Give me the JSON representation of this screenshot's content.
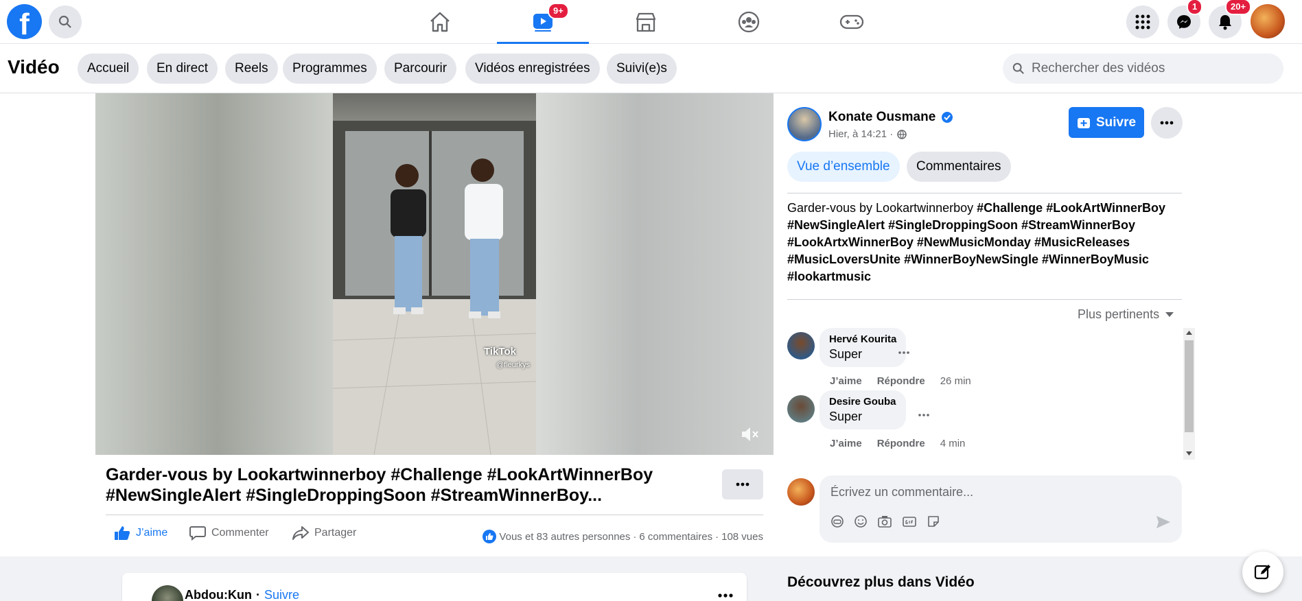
{
  "header": {
    "logo": "f",
    "nav_badges": {
      "video": "9+"
    },
    "right_badges": {
      "messenger": "1",
      "notifications": "20+"
    }
  },
  "subheader": {
    "title": "Vidéo",
    "chips": [
      "Accueil",
      "En direct",
      "Reels",
      "Programmes",
      "Parcourir",
      "Vidéos enregistrées",
      "Suivi(e)s"
    ],
    "search_placeholder": "Rechercher des vidéos"
  },
  "video": {
    "tiktok_label": "TikTok",
    "tiktok_handle": "@fleurkys",
    "title": "Garder-vous by Lookartwinnerboy #Challenge #LookArtWinnerBoy #NewSingleAlert #SingleDroppingSoon #StreamWinnerBoy...",
    "actions": {
      "like": "J’aime",
      "comment": "Commenter",
      "share": "Partager"
    },
    "reactions_text": "Vous et 83 autres personnes",
    "comments_count": "6 commentaires",
    "views": "108 vues"
  },
  "panel": {
    "author": "Konate Ousmane",
    "timestamp": "Hier, à 14:21 ·",
    "follow_label": "Suivre",
    "tabs": [
      "Vue d’ensemble",
      "Commentaires"
    ],
    "description_plain": "Garder-vous by Lookartwinnerboy ",
    "description_tags": [
      "#Challenge",
      "#LookArtWinnerBoy",
      "#NewSingleAlert",
      "#SingleDroppingSoon",
      "#StreamWinnerBoy",
      "#LookArtxWinnerBoy",
      "#NewMusicMonday",
      "#MusicReleases",
      "#MusicLoversUnite",
      "#WinnerBoyNewSingle",
      "#WinnerBoyMusic",
      "#lookartmusic"
    ],
    "sort_label": "Plus pertinents",
    "comments": [
      {
        "name": "Hervé Kourita",
        "text": "Super",
        "like": "J’aime",
        "reply": "Répondre",
        "time": "26 min"
      },
      {
        "name": "Desire Gouba",
        "text": "Super",
        "like": "J’aime",
        "reply": "Répondre",
        "time": "4 min"
      }
    ],
    "composer_placeholder": "Écrivez un commentaire..."
  },
  "feed": {
    "author": "Abdou:Kun",
    "separator": "·",
    "follow": "Suivre",
    "discover_title": "Découvrez plus dans Vidéo"
  },
  "colors": {
    "brand": "#1877f2",
    "badge": "#e41e3f",
    "chip_bg": "#e4e6eb"
  }
}
